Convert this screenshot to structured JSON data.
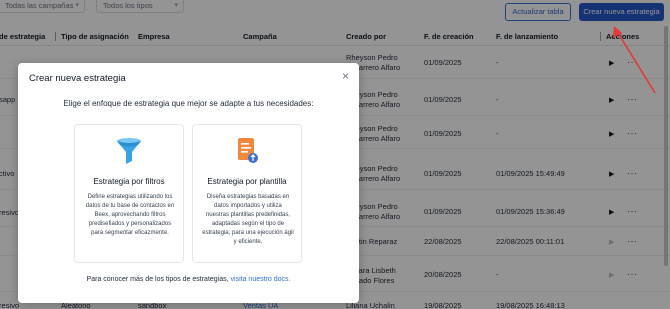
{
  "toolbar": {
    "filter_campaigns_placeholder": "Todas las campañas",
    "filter_types_value": "Todos los tipos",
    "refresh_label": "Actualizar tabla",
    "create_label": "Crear nueva estrategia"
  },
  "table": {
    "headers": [
      "de estrategia",
      "Tipo de asignación",
      "Empresa",
      "Campaña",
      "Creado por",
      "F. de creación",
      "F. de lanzamiento",
      "Acciones"
    ],
    "rows": [
      {
        "strategy": "",
        "creator_1": "Rheyson Pedro",
        "creator_2": "Socarrero Alfaro",
        "created": "01/09/2025",
        "launch": "-",
        "play_dim": false
      },
      {
        "strategy": "sapp",
        "creator_1": "Rheyson Pedro",
        "creator_2": "Socarrero Alfaro",
        "created": "01/09/2025",
        "launch": "-",
        "play_dim": false
      },
      {
        "strategy": "",
        "creator_1": "Rheyson Pedro",
        "creator_2": "Socarrero Alfaro",
        "created": "01/09/2025",
        "launch": "-",
        "play_dim": false
      },
      {
        "strategy": "ctivo",
        "creator_1": "Rheyson Pedro",
        "creator_2": "Socarrero Alfaro",
        "created": "01/09/2025",
        "launch": "01/09/2025 15:49:49",
        "play_dim": false
      },
      {
        "strategy": "resivo",
        "creator_1": "Rheyson Pedro",
        "creator_2": "Socarrero Alfaro",
        "created": "01/09/2025",
        "launch": "01/09/2025 15:36:49",
        "play_dim": false
      },
      {
        "strategy": "",
        "creator_1": "Kristin Reparaz",
        "creator_2": "",
        "created": "22/08/2025",
        "launch": "22/08/2025 00:11:01",
        "play_dim": true
      },
      {
        "strategy": "",
        "creator_1": "Yonara Lisbeth",
        "creator_2": "Collado Flores",
        "created": "20/08/2025",
        "launch": "-",
        "play_dim": true
      },
      {
        "strategy": "resivo",
        "assignment": "Aleatorio",
        "company": "sandbox",
        "campaign": "Ventas UA",
        "creator_1": "Liliana Uchalin",
        "creator_2": "",
        "created": "19/08/2025",
        "launch": "19/08/2025 16:48:13",
        "play_dim": false
      }
    ]
  },
  "modal": {
    "title": "Crear nueva estrategia",
    "subtitle": "Elige el enfoque de estrategia que mejor se adapte a tus necesidades:",
    "cards": [
      {
        "icon": "funnel-icon",
        "title": "Estrategia por filtros",
        "description": "Define estrategias utilizando los datos de tu base de contactos en Beex, aprovechando filtros predisefiados y personalizados para segmentar eficazmente."
      },
      {
        "icon": "template-document-icon",
        "title": "Estrategia por plantilla",
        "description": "Diseña estrategias basadas en datos importados y utiliza nuestras plantillas predefinidas, adaptadas según el tipo de estrategia, para una ejecución ágil y eficiente."
      }
    ],
    "footer_text": "Para conocer más de los tipos de estrategias,",
    "footer_link": "visita nuestro docs."
  },
  "colors": {
    "primary": "#2456c9",
    "link": "#2f6fd0",
    "annotation_arrow": "#e53935",
    "funnel_blue": "#3aa3e3",
    "template_orange": "#f0883e"
  }
}
